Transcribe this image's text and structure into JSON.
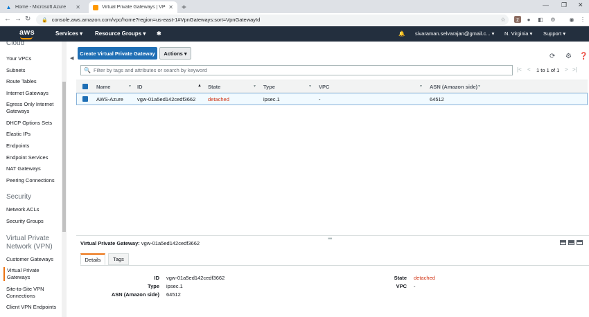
{
  "browser": {
    "tabs": [
      {
        "title": "Home - Microsoft Azure",
        "active": false,
        "icon": "azure-icon"
      },
      {
        "title": "Virtual Private Gateways | VPC M",
        "active": true,
        "icon": "aws-icon"
      }
    ],
    "url": "console.aws.amazon.com/vpc/home?region=us-east-1#VpnGateways:sort=VpnGatewayId"
  },
  "aws_nav": {
    "logo": "aws",
    "services": "Services",
    "resource_groups": "Resource Groups",
    "user": "sivaraman.selvarajan@gmail.c...",
    "region": "N. Virginia",
    "support": "Support"
  },
  "sidebar": {
    "top_partial": "Cloud",
    "items_a": [
      {
        "label": "Your VPCs"
      },
      {
        "label": "Subnets"
      },
      {
        "label": "Route Tables"
      },
      {
        "label": "Internet Gateways"
      },
      {
        "label": "Egress Only Internet Gateways"
      },
      {
        "label": "DHCP Options Sets"
      },
      {
        "label": "Elastic IPs"
      },
      {
        "label": "Endpoints"
      },
      {
        "label": "Endpoint Services"
      },
      {
        "label": "NAT Gateways"
      },
      {
        "label": "Peering Connections"
      }
    ],
    "section_security": "Security",
    "items_b": [
      {
        "label": "Network ACLs"
      },
      {
        "label": "Security Groups"
      }
    ],
    "section_vpn": "Virtual Private Network (VPN)",
    "items_c": [
      {
        "label": "Customer Gateways"
      },
      {
        "label": "Virtual Private Gateways",
        "active": true
      },
      {
        "label": "Site-to-Site VPN Connections"
      },
      {
        "label": "Client VPN Endpoints"
      }
    ]
  },
  "toolbar": {
    "create_label": "Create Virtual Private Gateway",
    "actions_label": "Actions"
  },
  "filter": {
    "placeholder": "Filter by tags and attributes or search by keyword"
  },
  "pagination": {
    "text": "1 to 1 of 1"
  },
  "table": {
    "columns": [
      "Name",
      "ID",
      "State",
      "Type",
      "VPC",
      "ASN (Amazon side)"
    ],
    "rows": [
      {
        "name": "AWS-Azure",
        "id": "vgw-01a5ed142cedf3662",
        "state": "detached",
        "type": "ipsec.1",
        "vpc": "-",
        "asn": "64512"
      }
    ]
  },
  "detail": {
    "title_label": "Virtual Private Gateway:",
    "title_value": "vgw-01a5ed142cedf3662",
    "tabs": [
      "Details",
      "Tags"
    ],
    "fields_left": [
      {
        "label": "ID",
        "value": "vgw-01a5ed142cedf3662"
      },
      {
        "label": "Type",
        "value": "ipsec.1"
      },
      {
        "label": "ASN (Amazon side)",
        "value": "64512"
      }
    ],
    "fields_right": [
      {
        "label": "State",
        "value": "detached"
      },
      {
        "label": "VPC",
        "value": "-"
      }
    ]
  },
  "colors": {
    "aws_nav_bg": "#232f3e",
    "primary_button": "#1f6fb5",
    "detached_state": "#d13212",
    "active_accent": "#ec7211"
  }
}
